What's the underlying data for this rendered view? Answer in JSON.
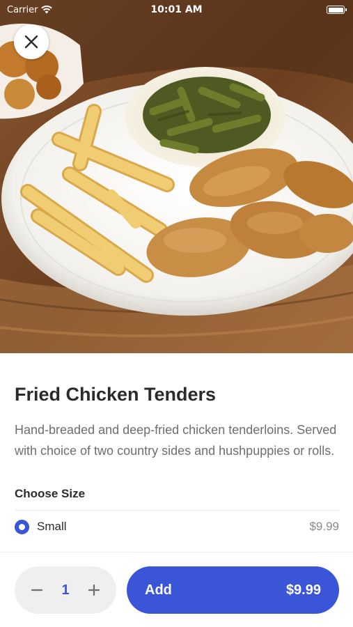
{
  "status_bar": {
    "carrier": "Carrier",
    "time": "10:01 AM"
  },
  "hero": {
    "image": "fried-chicken-tenders-plate-photo"
  },
  "close_icon": "close-icon",
  "item": {
    "name": "Fried Chicken Tenders",
    "description": "Hand-breaded and deep-fried chicken tenderloins. Served with choice of two country sides and hushpuppies or rolls."
  },
  "size": {
    "heading": "Choose Size",
    "options": [
      {
        "label": "Small",
        "price": "$9.99",
        "selected": true
      }
    ]
  },
  "order": {
    "quantity": "1",
    "add_label": "Add",
    "total": "$9.99"
  },
  "colors": {
    "accent": "#3a55d8",
    "stepper_bg": "#efefef"
  }
}
